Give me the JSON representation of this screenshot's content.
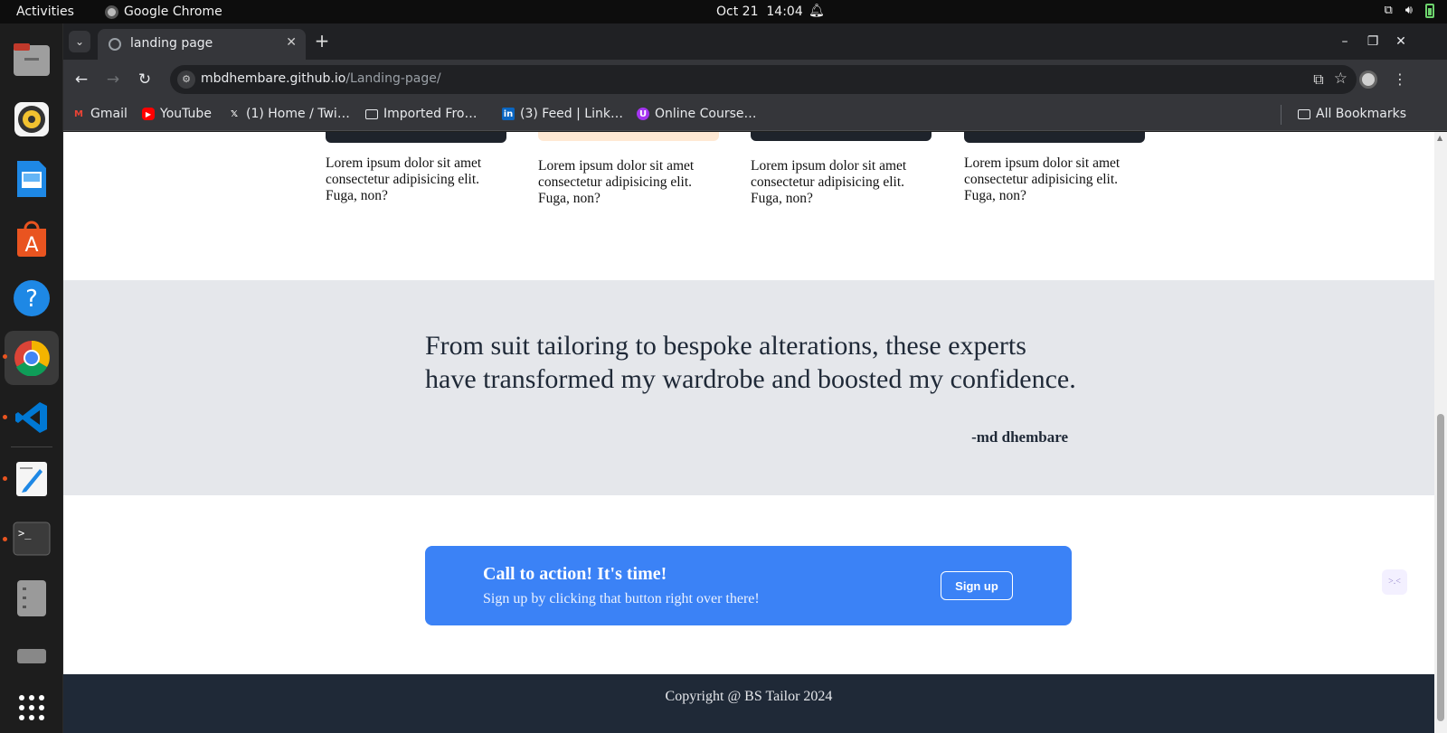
{
  "system_bar": {
    "activities": "Activities",
    "app_name": "Google Chrome",
    "date": "Oct 21",
    "time": "14:04"
  },
  "dock": {
    "apps": [
      "files-icon",
      "rhythmbox-icon",
      "writer-icon",
      "app-center-icon",
      "help-icon",
      "chrome-icon",
      "vscode-icon",
      "text-editor-icon",
      "terminal-icon",
      "disks-icon",
      "drive-icon",
      "show-apps-icon"
    ]
  },
  "browser": {
    "tab_title": "landing page",
    "url_host": "mbdhembare.github.io",
    "url_path": "/Landing-page/",
    "bookmarks": [
      {
        "label": "Gmail",
        "icon": "gmail-icon",
        "color": "#ea4335"
      },
      {
        "label": "YouTube",
        "icon": "youtube-icon",
        "color": "#ff0000"
      },
      {
        "label": "(1) Home / Twi…",
        "icon": "x-icon",
        "color": "#ffffff"
      },
      {
        "label": "Imported Fro…",
        "icon": "folder-icon",
        "color": "#e8eaed"
      },
      {
        "label": "(3) Feed | Link…",
        "icon": "linkedin-icon",
        "color": "#0a66c2"
      },
      {
        "label": "Online Course…",
        "icon": "udemy-icon",
        "color": "#a435f0"
      }
    ],
    "all_bookmarks": "All Bookmarks"
  },
  "page": {
    "cards": [
      {
        "text": "Lorem ipsum dolor sit amet consectetur adipisicing elit. Fuga, non?"
      },
      {
        "text": "Lorem ipsum dolor sit amet consectetur adipisicing elit. Fuga, non?"
      },
      {
        "text": "Lorem ipsum dolor sit amet consectetur adipisicing elit. Fuga, non?"
      },
      {
        "text": "Lorem ipsum dolor sit amet consectetur adipisicing elit. Fuga, non?"
      }
    ],
    "testimonial": {
      "quote": "From suit tailoring to bespoke alterations, these experts have transformed my wardrobe and boosted my confidence.",
      "author": "-md dhembare"
    },
    "cta": {
      "title": "Call to action! It's time!",
      "subtitle": "Sign up by clicking that button right over there!",
      "button": "Sign up",
      "color": "#3b82f6"
    },
    "footer": "Copyright @ BS Tailor 2024"
  }
}
